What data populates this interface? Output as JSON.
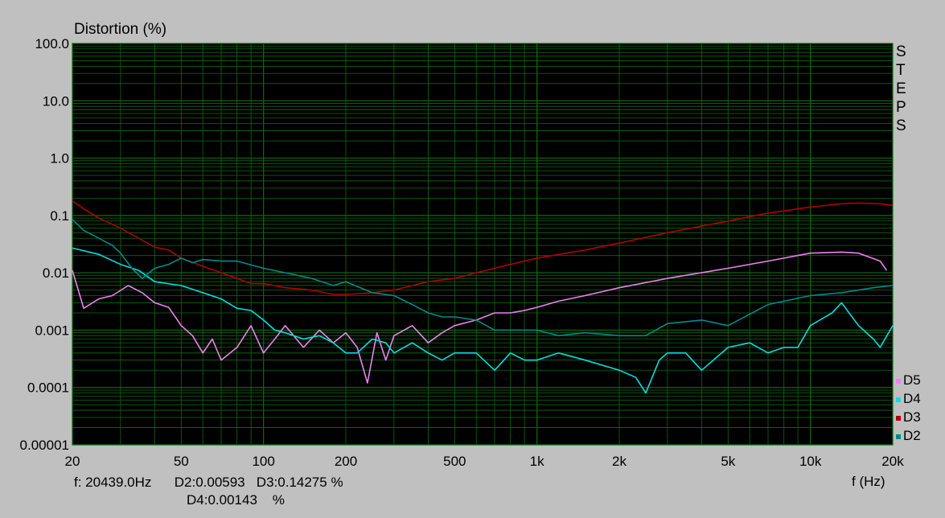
{
  "chart_data": {
    "type": "line",
    "title": "Distortion (%)",
    "ylabel": "Distortion (%)",
    "xlabel": "f (Hz)",
    "xscale": "log",
    "yscale": "log",
    "xlim": [
      20,
      20000
    ],
    "ylim": [
      1e-05,
      100
    ],
    "x_ticks": [
      {
        "v": 20,
        "label": "20"
      },
      {
        "v": 50,
        "label": "50"
      },
      {
        "v": 100,
        "label": "100"
      },
      {
        "v": 200,
        "label": "200"
      },
      {
        "v": 500,
        "label": "500"
      },
      {
        "v": 1000,
        "label": "1k"
      },
      {
        "v": 2000,
        "label": "2k"
      },
      {
        "v": 5000,
        "label": "5k"
      },
      {
        "v": 10000,
        "label": "10k"
      },
      {
        "v": 20000,
        "label": "20k"
      }
    ],
    "y_ticks": [
      {
        "v": 100,
        "label": "100.0"
      },
      {
        "v": 10,
        "label": "10.0"
      },
      {
        "v": 1,
        "label": "1.0"
      },
      {
        "v": 0.1,
        "label": "0.1"
      },
      {
        "v": 0.01,
        "label": "0.01"
      },
      {
        "v": 0.001,
        "label": "0.001"
      },
      {
        "v": 0.0001,
        "label": "0.0001"
      },
      {
        "v": 1e-05,
        "label": "0.00001"
      }
    ],
    "grid": true,
    "background": "#000000",
    "grid_color": "#0f6a0f",
    "legend_position": "right-bottom",
    "series": [
      {
        "name": "D5",
        "color": "#ee82ee",
        "x": [
          20,
          22,
          25,
          28,
          32,
          36,
          40,
          45,
          50,
          55,
          60,
          65,
          70,
          80,
          90,
          100,
          110,
          120,
          140,
          160,
          180,
          200,
          220,
          240,
          260,
          280,
          300,
          350,
          400,
          450,
          500,
          600,
          700,
          800,
          900,
          1000,
          1200,
          1500,
          2000,
          3000,
          5000,
          7000,
          10000,
          13000,
          15000,
          18000,
          19000
        ],
        "y": [
          0.011,
          0.0024,
          0.0035,
          0.004,
          0.006,
          0.0045,
          0.003,
          0.0025,
          0.0012,
          0.0008,
          0.0004,
          0.0007,
          0.0003,
          0.0005,
          0.0012,
          0.0004,
          0.0007,
          0.0012,
          0.0005,
          0.001,
          0.0006,
          0.0009,
          0.0005,
          0.00012,
          0.0009,
          0.0003,
          0.0008,
          0.0012,
          0.0006,
          0.0009,
          0.0012,
          0.0015,
          0.002,
          0.002,
          0.0022,
          0.0025,
          0.0032,
          0.004,
          0.0055,
          0.008,
          0.012,
          0.016,
          0.022,
          0.023,
          0.022,
          0.016,
          0.011
        ]
      },
      {
        "name": "D4",
        "color": "#00e0e0",
        "x": [
          20,
          25,
          30,
          35,
          40,
          50,
          60,
          70,
          80,
          90,
          100,
          110,
          120,
          140,
          160,
          180,
          200,
          220,
          250,
          280,
          300,
          350,
          400,
          450,
          500,
          600,
          700,
          800,
          900,
          1000,
          1200,
          1500,
          2000,
          2300,
          2500,
          2800,
          3000,
          3500,
          4000,
          5000,
          6000,
          7000,
          8000,
          9000,
          10000,
          12000,
          13000,
          15000,
          17000,
          18000,
          20000
        ],
        "y": [
          0.027,
          0.021,
          0.014,
          0.011,
          0.007,
          0.006,
          0.0045,
          0.0035,
          0.0024,
          0.0022,
          0.0015,
          0.001,
          0.0009,
          0.0007,
          0.0008,
          0.0006,
          0.0004,
          0.0004,
          0.0007,
          0.0006,
          0.0004,
          0.0006,
          0.0004,
          0.0003,
          0.0004,
          0.0004,
          0.0002,
          0.0004,
          0.0003,
          0.0003,
          0.0004,
          0.0003,
          0.0002,
          0.00015,
          8e-05,
          0.0003,
          0.0004,
          0.0004,
          0.0002,
          0.0005,
          0.0006,
          0.0004,
          0.0005,
          0.0005,
          0.0012,
          0.002,
          0.003,
          0.0012,
          0.0007,
          0.0005,
          0.0012
        ]
      },
      {
        "name": "D3",
        "color": "#b00000",
        "x": [
          20,
          22,
          25,
          30,
          35,
          40,
          45,
          50,
          60,
          70,
          80,
          90,
          100,
          120,
          150,
          180,
          200,
          250,
          300,
          350,
          400,
          500,
          600,
          800,
          1000,
          1500,
          2000,
          3000,
          5000,
          7000,
          10000,
          13000,
          15000,
          18000,
          20000
        ],
        "y": [
          0.18,
          0.13,
          0.09,
          0.06,
          0.04,
          0.028,
          0.025,
          0.018,
          0.013,
          0.01,
          0.008,
          0.0065,
          0.0065,
          0.0055,
          0.005,
          0.0042,
          0.0042,
          0.0045,
          0.005,
          0.006,
          0.007,
          0.008,
          0.01,
          0.014,
          0.018,
          0.025,
          0.033,
          0.05,
          0.08,
          0.11,
          0.14,
          0.16,
          0.165,
          0.16,
          0.15
        ]
      },
      {
        "name": "D2",
        "color": "#008b8b",
        "x": [
          20,
          22,
          25,
          28,
          30,
          33,
          36,
          40,
          45,
          50,
          55,
          60,
          70,
          80,
          100,
          120,
          150,
          180,
          200,
          250,
          300,
          350,
          400,
          450,
          500,
          600,
          700,
          800,
          1000,
          1200,
          1500,
          2000,
          2500,
          3000,
          4000,
          5000,
          7000,
          10000,
          13000,
          15000,
          17000,
          20000
        ],
        "y": [
          0.085,
          0.055,
          0.04,
          0.03,
          0.022,
          0.012,
          0.008,
          0.012,
          0.014,
          0.018,
          0.015,
          0.017,
          0.016,
          0.016,
          0.012,
          0.01,
          0.008,
          0.006,
          0.007,
          0.0045,
          0.004,
          0.0028,
          0.002,
          0.0017,
          0.0017,
          0.0015,
          0.001,
          0.001,
          0.001,
          0.0008,
          0.0009,
          0.0008,
          0.0008,
          0.0013,
          0.0015,
          0.0012,
          0.0028,
          0.004,
          0.0045,
          0.005,
          0.0055,
          0.006
        ]
      }
    ]
  },
  "side_label": "STEPS",
  "readout": {
    "line1": "f: 20439.0Hz      D2:0.00593   D3:0.14275 %",
    "line2": "D4:0.00143    %"
  }
}
